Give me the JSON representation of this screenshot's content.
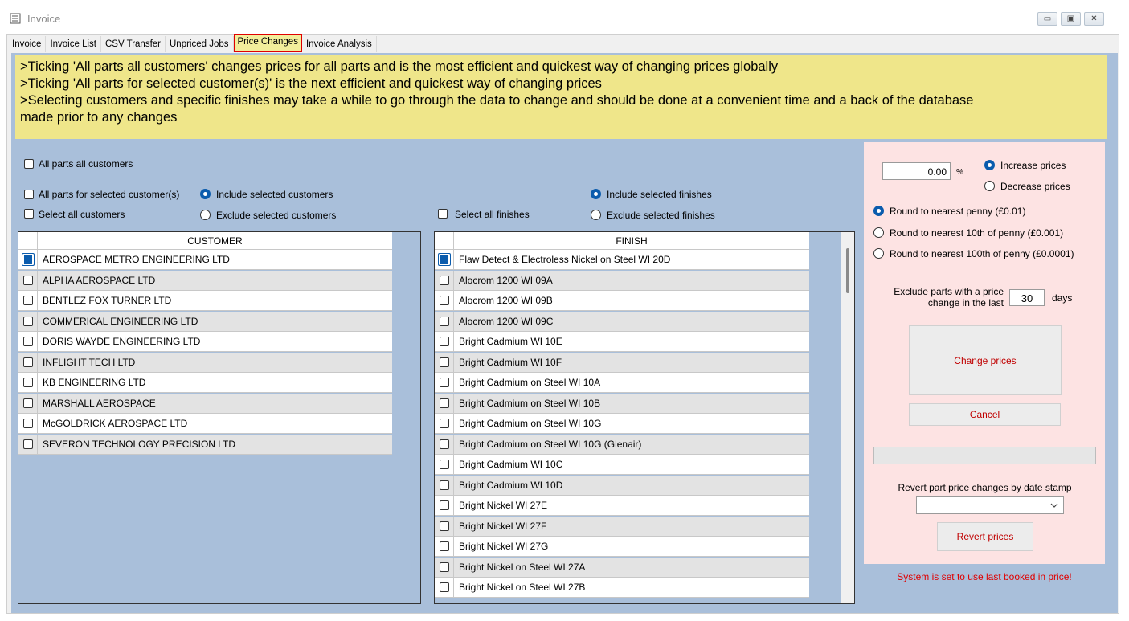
{
  "window": {
    "title": "Invoice",
    "minimize": "▭",
    "maximize": "▣",
    "close": "✕"
  },
  "tabs": [
    {
      "label": "Invoice",
      "active": false
    },
    {
      "label": "Invoice List",
      "active": false
    },
    {
      "label": "CSV Transfer",
      "active": false
    },
    {
      "label": "Unpriced Jobs",
      "active": false
    },
    {
      "label": "Price Changes",
      "active": true
    },
    {
      "label": "Invoice Analysis",
      "active": false
    }
  ],
  "banner": {
    "line1": ">Ticking 'All parts all customers' changes prices for all parts and is the most efficient and quickest way of changing prices globally",
    "line2": ">Ticking 'All parts for selected customer(s)' is the next efficient and quickest way of changing prices",
    "line3": ">Selecting customers and specific finishes may take a while to go through the data to change and should be done at a convenient time and a back of the database",
    "line4": "made prior to any changes"
  },
  "options": {
    "all_parts_all_customers": "All parts all customers",
    "all_parts_selected_customers": "All parts for selected customer(s)",
    "select_all_customers": "Select all customers",
    "include_selected_customers": "Include selected customers",
    "exclude_selected_customers": "Exclude selected customers",
    "select_all_finishes": "Select all finishes",
    "include_selected_finishes": "Include selected finishes",
    "exclude_selected_finishes": "Exclude selected finishes"
  },
  "customer_grid": {
    "header": "CUSTOMER",
    "rows": [
      "AEROSPACE METRO ENGINEERING LTD",
      "ALPHA AEROSPACE LTD",
      "BENTLEZ FOX TURNER LTD",
      "COMMERICAL ENGINEERING LTD",
      "DORIS WAYDE ENGINEERING LTD",
      "INFLIGHT TECH LTD",
      "KB ENGINEERING LTD",
      "MARSHALL AEROSPACE",
      "McGOLDRICK AEROSPACE LTD",
      "SEVERON TECHNOLOGY PRECISION LTD"
    ]
  },
  "finish_grid": {
    "header": "FINISH",
    "rows": [
      "Flaw Detect & Electroless Nickel on Steel WI 20D",
      "Alocrom 1200  WI 09A",
      "Alocrom 1200  WI 09B",
      "Alocrom 1200  WI 09C",
      "Bright Cadmium  WI 10E",
      "Bright Cadmium  WI 10F",
      "Bright Cadmium on Steel WI 10A",
      "Bright Cadmium on Steel WI 10B",
      "Bright Cadmium on Steel WI 10G",
      "Bright Cadmium on Steel WI 10G (Glenair)",
      "Bright Cadmium WI 10C",
      "Bright Cadmium WI 10D",
      "Bright Nickel  WI 27E",
      "Bright Nickel  WI 27F",
      "Bright Nickel  WI 27G",
      "Bright Nickel on Steel WI 27A",
      "Bright Nickel on Steel WI 27B"
    ]
  },
  "price_panel": {
    "percent_value": "0.00",
    "percent_symbol": "%",
    "increase_prices": "Increase prices",
    "decrease_prices": "Decrease prices",
    "round_penny": "Round to nearest penny (£0.01)",
    "round_10th": "Round to nearest 10th of penny (£0.001)",
    "round_100th": "Round to nearest 100th of penny (£0.0001)",
    "exclude_label_1": "Exclude parts with a price",
    "exclude_label_2": "change in the last",
    "exclude_days_value": "30",
    "days_label": "days",
    "change_prices_button": "Change prices",
    "cancel_button": "Cancel",
    "revert_label": "Revert part price changes by date stamp",
    "revert_select_value": "",
    "revert_button": "Revert prices",
    "system_note": "System is set to use last booked in price!"
  },
  "colors": {
    "banner_bg": "#efe68a",
    "panel_bg": "#a9bfda",
    "right_panel_bg": "#fde3e3",
    "active_tab_border": "#e00000",
    "button_text": "#c00000"
  }
}
